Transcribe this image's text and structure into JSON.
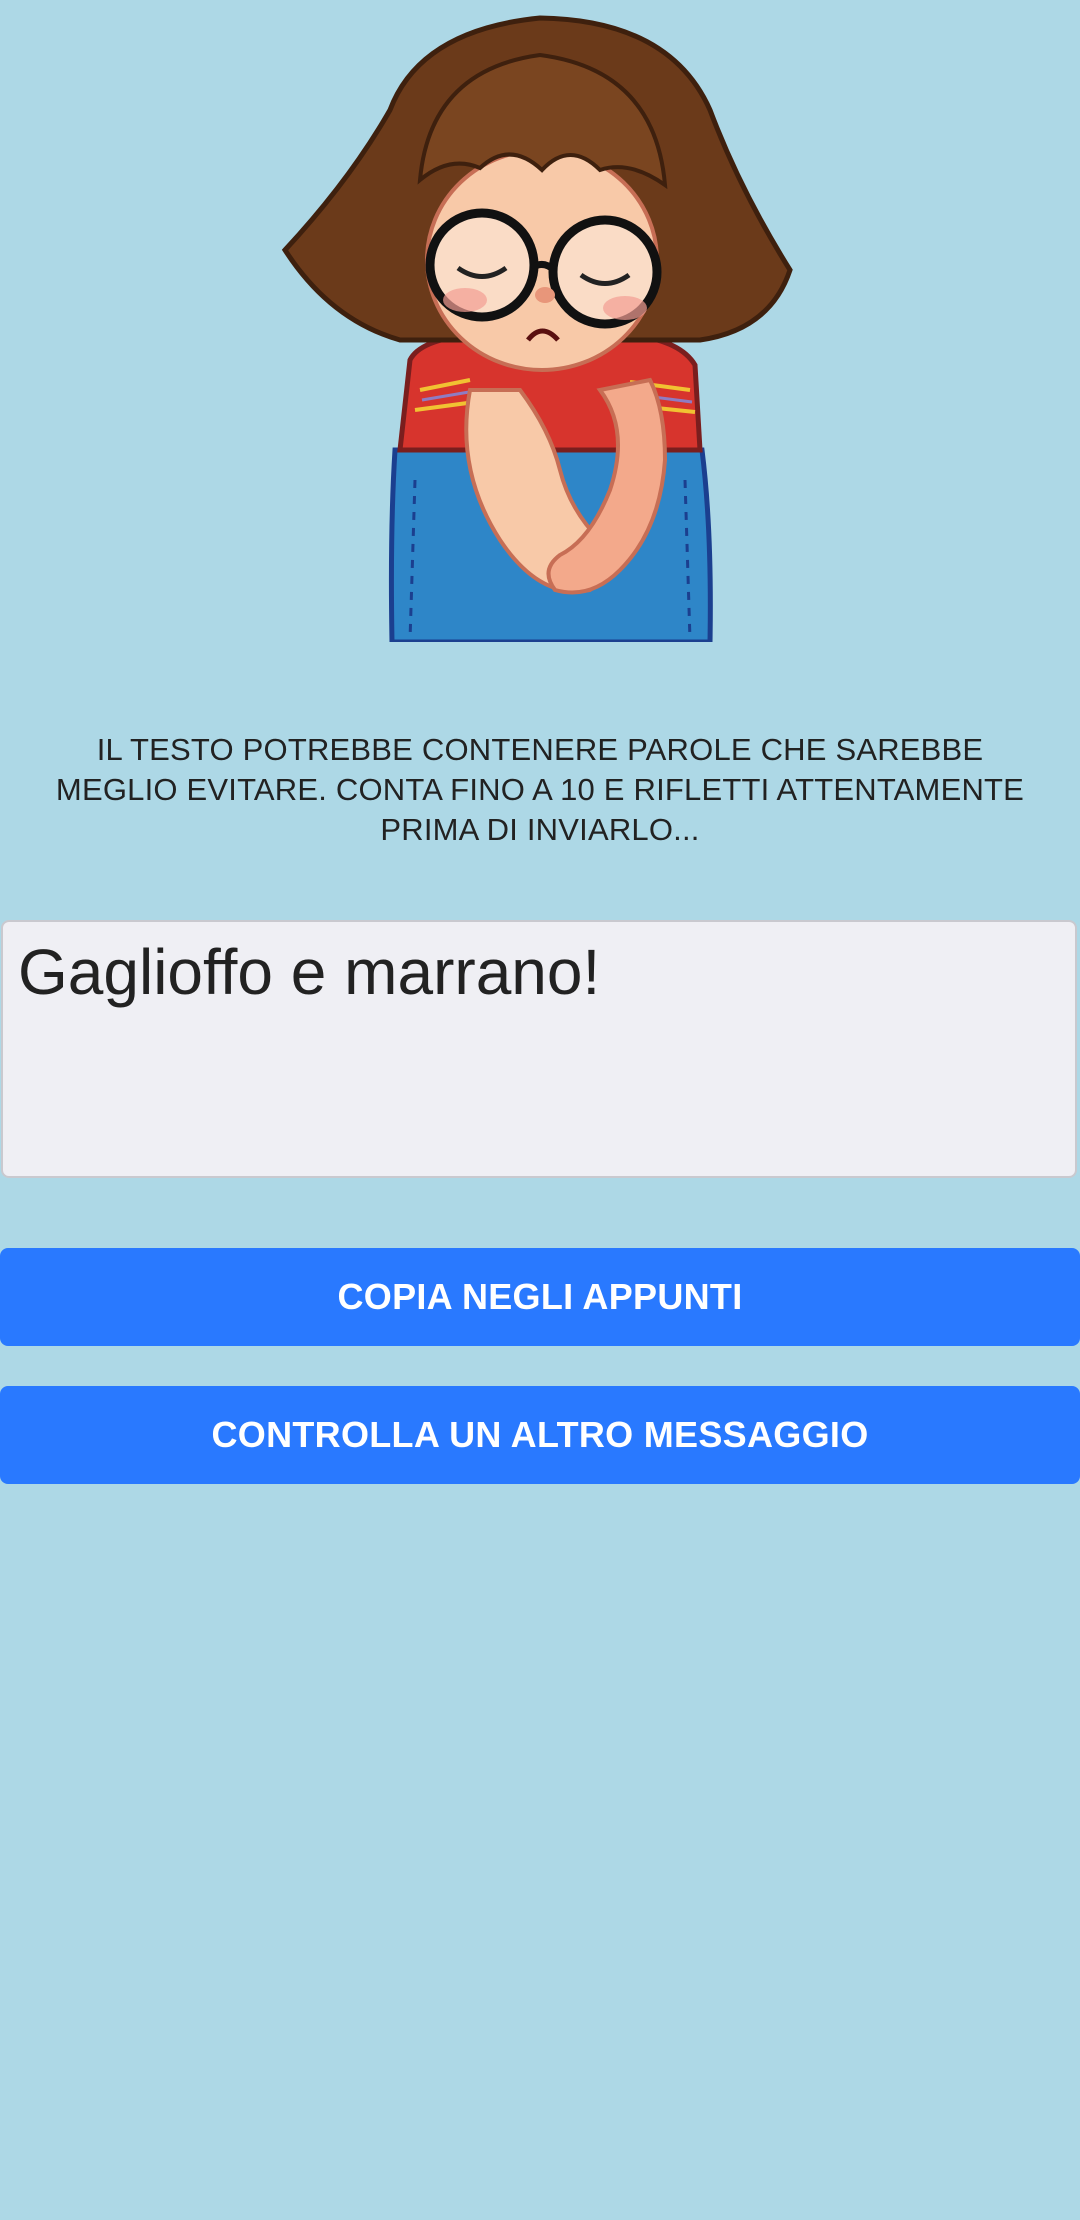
{
  "illustration": {
    "icon": "sad-girl-sticker-icon",
    "colors": {
      "background": "#ADD8E6",
      "hair": "#6B3A1A",
      "skin": "#F8C9A8",
      "shirt": "#D7342D",
      "overalls": "#2E86C8"
    }
  },
  "warning": {
    "text": "IL TESTO POTREBBE CONTENERE PAROLE CHE SAREBBE MEGLIO EVITARE. CONTA FINO A 10 E RIFLETTI ATTENTAMENTE PRIMA DI INVIARLO..."
  },
  "message": {
    "value": "Gaglioffo e marrano!"
  },
  "buttons": {
    "copy_label": "COPIA NEGLI APPUNTI",
    "check_label": "CONTROLLA UN ALTRO MESSAGGIO",
    "color": "#2979FF"
  }
}
